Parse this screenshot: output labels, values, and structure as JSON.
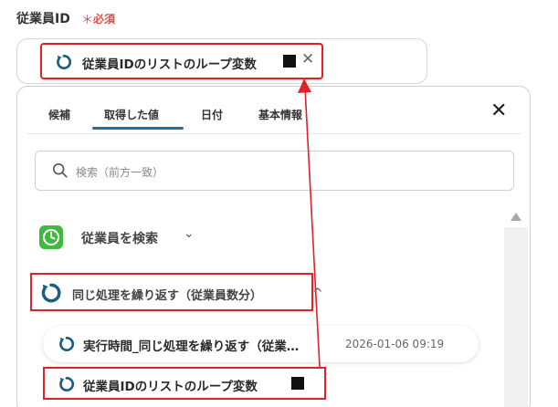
{
  "field": {
    "label": "従業員ID",
    "required_mark": "＊",
    "required_text": "必須",
    "token": {
      "text": "従業員IDのリストのループ変数",
      "icon": "loop-icon",
      "close": "✕"
    }
  },
  "panel": {
    "tabs": [
      {
        "label": "候補",
        "active": false
      },
      {
        "label": "取得した値",
        "active": true
      },
      {
        "label": "日付",
        "active": false
      },
      {
        "label": "基本情報",
        "active": false
      }
    ],
    "close_icon": "✕",
    "search": {
      "placeholder": "検索（前方一致）",
      "icon": "search-icon"
    },
    "groups": [
      {
        "label": "従業員を検索",
        "icon": "clock-app-icon",
        "chevron": "⌄",
        "expanded": false
      },
      {
        "label": "同じ処理を繰り返す（従業員数分）",
        "icon": "loop-icon",
        "chevron": "^",
        "expanded": true
      }
    ],
    "items": [
      {
        "label": "実行時間_同じ処理を繰り返す（従業…",
        "timestamp": "2026-01-06 09:19",
        "icon": "loop-icon"
      },
      {
        "label": "従業員IDのリストのループ変数",
        "icon": "loop-icon"
      }
    ]
  },
  "colors": {
    "highlight_red": "#e1202a",
    "required_red": "#e54b4b",
    "tab_underline": "#1f6eb5",
    "loop_icon_teal": "#1b5e82",
    "app_green": "#41b93f"
  }
}
